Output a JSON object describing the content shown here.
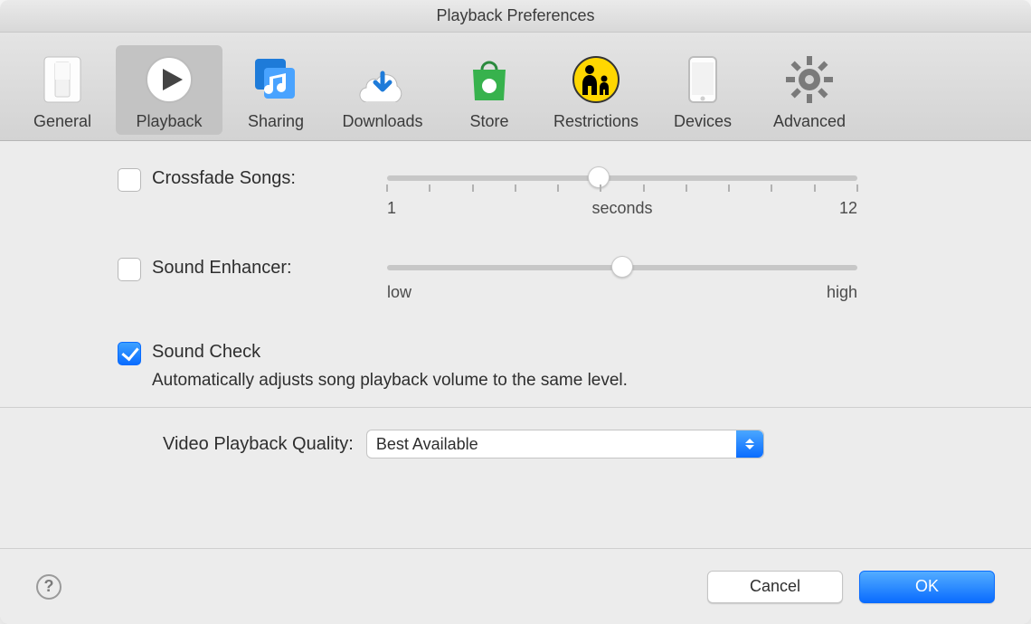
{
  "window": {
    "title": "Playback Preferences"
  },
  "toolbar": {
    "tabs": [
      {
        "id": "general",
        "label": "General",
        "icon": "switch-icon"
      },
      {
        "id": "playback",
        "label": "Playback",
        "icon": "play-icon",
        "selected": true
      },
      {
        "id": "sharing",
        "label": "Sharing",
        "icon": "music-share-icon"
      },
      {
        "id": "downloads",
        "label": "Downloads",
        "icon": "cloud-download-icon"
      },
      {
        "id": "store",
        "label": "Store",
        "icon": "shopping-bag-icon"
      },
      {
        "id": "restrictions",
        "label": "Restrictions",
        "icon": "parental-icon"
      },
      {
        "id": "devices",
        "label": "Devices",
        "icon": "phone-icon"
      },
      {
        "id": "advanced",
        "label": "Advanced",
        "icon": "gear-icon"
      }
    ]
  },
  "options": {
    "crossfade": {
      "label": "Crossfade Songs:",
      "checked": false,
      "slider": {
        "min": 1,
        "max": 12,
        "value": 6,
        "min_label": "1",
        "max_label": "12",
        "center_label": "seconds",
        "ticks": 12
      }
    },
    "enhancer": {
      "label": "Sound Enhancer:",
      "checked": false,
      "slider": {
        "min": 0,
        "max": 100,
        "value": 50,
        "min_label": "low",
        "max_label": "high",
        "ticks": 0
      }
    },
    "sound_check": {
      "label": "Sound Check",
      "checked": true,
      "description": "Automatically adjusts song playback volume to the same level."
    }
  },
  "video_quality": {
    "label": "Video Playback Quality:",
    "value": "Best Available"
  },
  "footer": {
    "help_label": "?",
    "cancel": "Cancel",
    "ok": "OK"
  },
  "colors": {
    "accent": "#0a6cff"
  }
}
